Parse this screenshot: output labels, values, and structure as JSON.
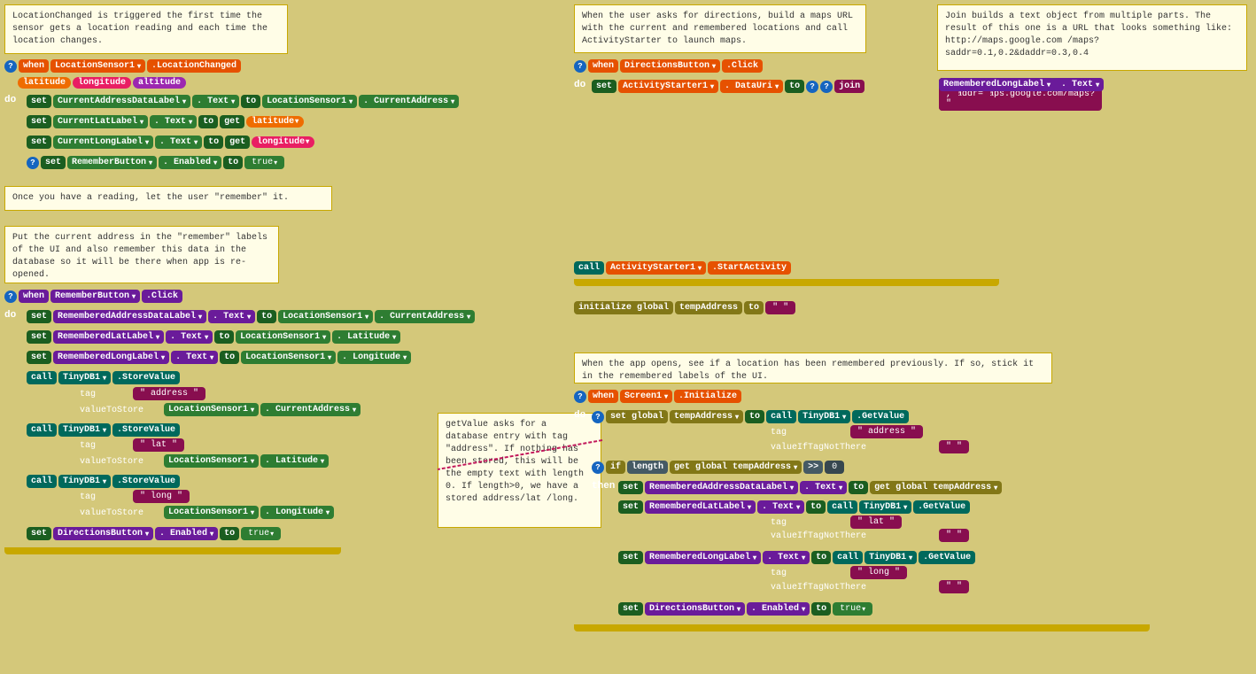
{
  "comments": {
    "c1": "LocationChanged is triggered the first time the sensor gets a location\nreading and each time the location changes.",
    "c2": "Once you have a reading, let the user \"remember\" it.",
    "c3": "Put the current address in the \"remember\" labels of the\nUI and also remember this data in the database so it\nwill be there when app is re-opened.",
    "c4": "When the user asks for directions, build a maps URL\nwith the current and remembered locations and call\nActivityStarter to launch maps.",
    "c5": "Join builds a text object from multiple parts.\nThe result of this one is a URL that looks\nsomething like: http://maps.google.com\n/maps?saddr=0.1,0.2&daddr=0.3,0.4",
    "c6": "getValue asks for a\ndatabase entry with\ntag \"address\". If\nnothing has been\nstored, this will\nbe the empty text\nwith length 0. If\nlength>0, we have a\nstored address/lat\n/long.",
    "c7": "When the app opens, see if a location has been remembered previously.\nIf so, stick it in the remembered labels of the UI."
  }
}
